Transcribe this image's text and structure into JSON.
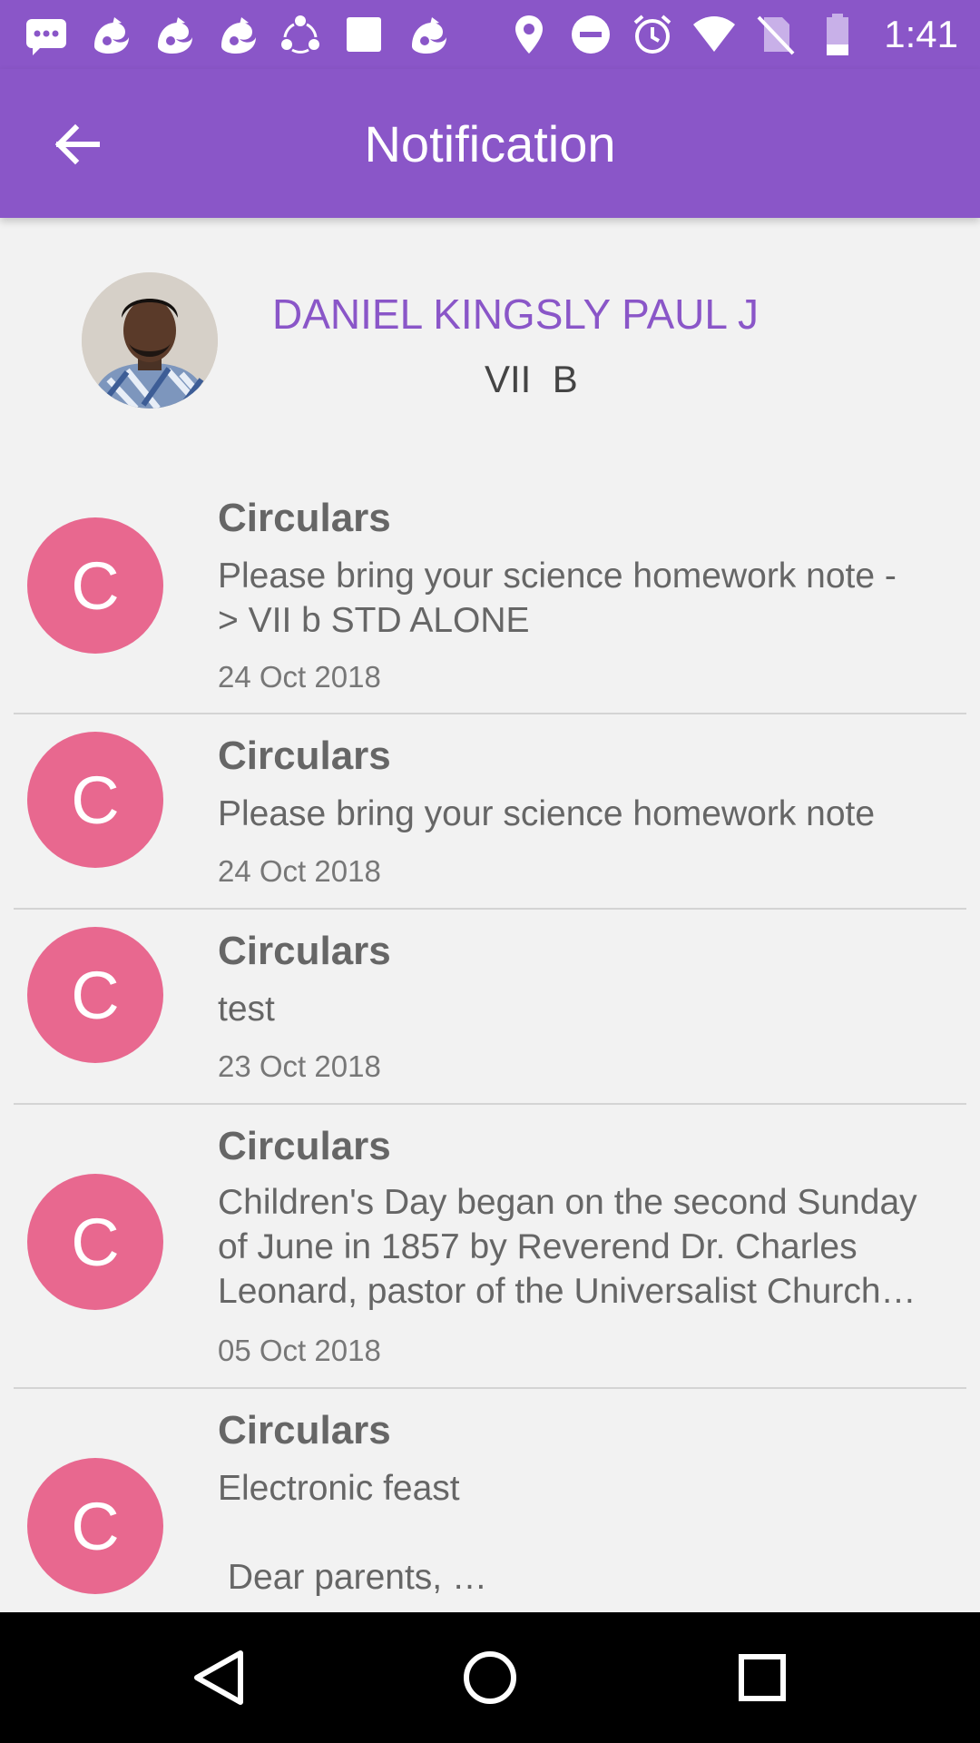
{
  "status_bar": {
    "time": "1:41",
    "left_icons": [
      "messages-icon",
      "uc-browser-icon",
      "uc-browser-icon",
      "uc-browser-icon",
      "share-icon",
      "square-app-icon",
      "uc-browser-icon"
    ],
    "right_icons": [
      "location-icon",
      "do-not-disturb-icon",
      "alarm-icon",
      "wifi-icon",
      "no-sim-icon",
      "battery-icon"
    ]
  },
  "app_bar": {
    "title": "Notification",
    "back_icon": "arrow-back-icon",
    "background": "#8a56c8"
  },
  "profile": {
    "name": "DANIEL KINGSLY PAUL J",
    "class": "VII  B",
    "name_color": "#8a56c8"
  },
  "notifications": [
    {
      "initial": "C",
      "title": "Circulars",
      "body": "Please bring your science homework note -\n> VII b STD ALONE",
      "date": "24 Oct 2018"
    },
    {
      "initial": "C",
      "title": "Circulars",
      "body": "Please bring your science homework note",
      "date": "24 Oct 2018"
    },
    {
      "initial": "C",
      "title": "Circulars",
      "body": "test",
      "date": "23 Oct 2018"
    },
    {
      "initial": "C",
      "title": "Circulars",
      "body": "Children's Day began on the second Sunday\nof June in 1857 by Reverend Dr. Charles\nLeonard, pastor of the Universalist Church…",
      "date": "05 Oct 2018"
    },
    {
      "initial": "C",
      "title": "Circulars",
      "body": "Electronic feast\n\n Dear parents, …",
      "date": ""
    }
  ],
  "colors": {
    "accent": "#8a56c8",
    "notification_avatar": "#e8688f"
  },
  "nav_bar": {
    "back_icon": "nav-back-icon",
    "home_icon": "nav-home-icon",
    "recents_icon": "nav-recents-icon"
  }
}
